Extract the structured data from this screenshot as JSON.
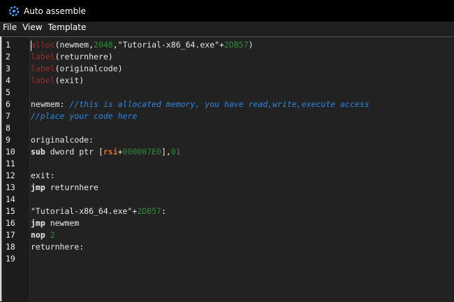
{
  "window": {
    "title": "Auto assemble",
    "icon": "cheat-engine-icon"
  },
  "menu": {
    "items": [
      "File",
      "View",
      "Template"
    ]
  },
  "colors": {
    "keyword": "#a22a2a",
    "number": "#2f8a3a",
    "register": "#e07020",
    "comment": "#2e86de",
    "text": "#e8e8e8",
    "background": "#222222"
  },
  "editor": {
    "line_numbers": [
      "1",
      "2",
      "3",
      "4",
      "5",
      "6",
      "7",
      "8",
      "9",
      "10",
      "11",
      "12",
      "13",
      "14",
      "15",
      "16",
      "17",
      "18",
      "19"
    ],
    "lines": [
      [
        {
          "t": "kw",
          "v": "alloc"
        },
        {
          "t": "txt",
          "v": "(newmem,"
        },
        {
          "t": "num",
          "v": "2048"
        },
        {
          "t": "txt",
          "v": ",\"Tutorial-x86_64.exe\"+"
        },
        {
          "t": "num",
          "v": "2DB57"
        },
        {
          "t": "txt",
          "v": ")"
        }
      ],
      [
        {
          "t": "kw",
          "v": "label"
        },
        {
          "t": "txt",
          "v": "(returnhere)"
        }
      ],
      [
        {
          "t": "kw",
          "v": "label"
        },
        {
          "t": "txt",
          "v": "(originalcode)"
        }
      ],
      [
        {
          "t": "kw",
          "v": "label"
        },
        {
          "t": "txt",
          "v": "(exit)"
        }
      ],
      [],
      [
        {
          "t": "txt",
          "v": "newmem: "
        },
        {
          "t": "cmt",
          "v": "//this is allocated memory, you have read,write,execute access"
        }
      ],
      [
        {
          "t": "cmt",
          "v": "//place your code here"
        }
      ],
      [],
      [
        {
          "t": "txt",
          "v": "originalcode:"
        }
      ],
      [
        {
          "t": "bold",
          "v": "sub"
        },
        {
          "t": "txt",
          "v": " dword ptr ["
        },
        {
          "t": "reg",
          "v": "rsi"
        },
        {
          "t": "txt",
          "v": "+"
        },
        {
          "t": "num",
          "v": "000007E0"
        },
        {
          "t": "txt",
          "v": "],"
        },
        {
          "t": "num",
          "v": "01"
        }
      ],
      [],
      [
        {
          "t": "txt",
          "v": "exit:"
        }
      ],
      [
        {
          "t": "bold",
          "v": "jmp"
        },
        {
          "t": "txt",
          "v": " returnhere"
        }
      ],
      [],
      [
        {
          "t": "txt",
          "v": "\"Tutorial-x86_64.exe\"+"
        },
        {
          "t": "num",
          "v": "2DB57"
        },
        {
          "t": "txt",
          "v": ":"
        }
      ],
      [
        {
          "t": "bold",
          "v": "jmp"
        },
        {
          "t": "txt",
          "v": " newmem"
        }
      ],
      [
        {
          "t": "bold",
          "v": "nop"
        },
        {
          "t": "txt",
          "v": " "
        },
        {
          "t": "num",
          "v": "2"
        }
      ],
      [
        {
          "t": "txt",
          "v": "returnhere:"
        }
      ],
      []
    ]
  }
}
